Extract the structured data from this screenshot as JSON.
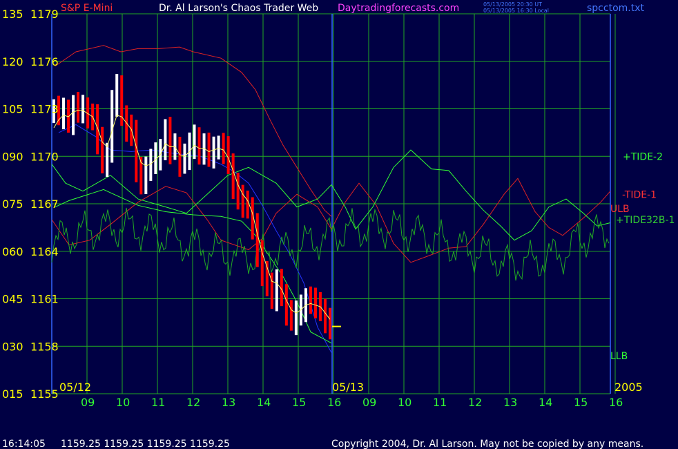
{
  "header": {
    "instrument": "S&P E-Mini",
    "title": "Dr. Al Larson's Chaos Trader Web",
    "site": "Daytradingforecasts.com",
    "time1": "05/13/2005 20:30 UT",
    "time2": "05/13/2005 16:30 Local",
    "file": "spcctom.txt"
  },
  "dates": {
    "left": "05/12",
    "mid": "05/13",
    "year": "2005"
  },
  "footer": {
    "time": "16:14:05",
    "ohlc": "1159.25 1159.25 1159.25 1159.25",
    "copyright": "Copyright 2004, Dr. Al Larson. May not be copied by any means."
  },
  "colors": {
    "background": "#000044",
    "grid": "#22aa22",
    "axis": "#3366ff",
    "price_up": "#ffffff",
    "price_down": "#ff0000"
  },
  "chart_data": {
    "type": "line",
    "title": "S&P E-Mini",
    "y_left_ticks": [
      "015",
      "030",
      "045",
      "060",
      "075",
      "090",
      "105",
      "120",
      "135"
    ],
    "y_price_ticks": [
      "1155",
      "1158",
      "1161",
      "1164",
      "1167",
      "1170",
      "1173",
      "1176",
      "1179"
    ],
    "ylim": [
      1155,
      1179
    ],
    "x_ticks": [
      "09",
      "10",
      "11",
      "12",
      "13",
      "14",
      "15",
      "16",
      "09",
      "10",
      "11",
      "12",
      "13",
      "14",
      "15",
      "16"
    ],
    "session_dates": [
      "05/12",
      "05/13"
    ],
    "series_labels": [
      {
        "name": "+TIDE-2",
        "color": "#33ff33"
      },
      {
        "name": "-TIDE-1",
        "color": "#ff3333"
      },
      {
        "name": "ULB",
        "color": "#ff3333"
      },
      {
        "name": "+TIDE32B-1",
        "color": "#33cc33"
      },
      {
        "name": "LLB",
        "color": "#33ff33"
      }
    ],
    "price": [
      1173.0,
      1172.6,
      1172.8,
      1172.2,
      1173.2,
      1172.9,
      1173.0,
      1172.6,
      1172.4,
      1171.0,
      1169.6,
      1170.2,
      1173.4,
      1174.3,
      1172.6,
      1171.8,
      1171.4,
      1169.2,
      1168.4,
      1169.3,
      1169.6,
      1170.0,
      1170.4,
      1171.6,
      1170.4,
      1170.6,
      1169.6,
      1170.0,
      1170.6,
      1171.2,
      1170.3,
      1170.6,
      1170.1,
      1170.5,
      1170.6,
      1170.4,
      1169.5,
      1168.2,
      1167.3,
      1167.0,
      1166.8,
      1165.6,
      1163.8,
      1162.6,
      1162.0,
      1161.1,
      1162.0,
      1161.2,
      1160.2,
      1159.6,
      1160.0,
      1160.4,
      1161.0,
      1160.8,
      1160.6,
      1160.4,
      1159.6,
      1159.3
    ],
    "ma_fast": [
      1171.8,
      1172.3,
      1172.6,
      1172.5,
      1172.8,
      1172.9,
      1172.9,
      1172.7,
      1172.5,
      1171.8,
      1170.9,
      1170.6,
      1171.6,
      1172.6,
      1172.5,
      1172.1,
      1171.7,
      1170.6,
      1169.6,
      1169.4,
      1169.5,
      1169.8,
      1170.1,
      1170.8,
      1170.6,
      1170.6,
      1170.1,
      1170.0,
      1170.3,
      1170.7,
      1170.5,
      1170.5,
      1170.3,
      1170.4,
      1170.5,
      1170.4,
      1169.9,
      1169.1,
      1168.2,
      1167.6,
      1167.2,
      1166.4,
      1165.1,
      1163.9,
      1163.0,
      1162.1,
      1162.0,
      1161.6,
      1160.9,
      1160.3,
      1160.1,
      1160.3,
      1160.6,
      1160.7,
      1160.6,
      1160.5,
      1160.1,
      1159.7
    ],
    "tide2": [
      [
        75,
        1169.5
      ],
      [
        95,
        1168.3
      ],
      [
        120,
        1167.8
      ],
      [
        160,
        1168.8
      ],
      [
        200,
        1167.3
      ],
      [
        240,
        1166.8
      ],
      [
        270,
        1166.4
      ],
      [
        300,
        1167.6
      ],
      [
        330,
        1168.8
      ],
      [
        360,
        1169.3
      ],
      [
        400,
        1168.3
      ],
      [
        430,
        1166.8
      ],
      [
        460,
        1167.3
      ],
      [
        480,
        1168.2
      ],
      [
        500,
        1166.8
      ],
      [
        515,
        1165.4
      ],
      [
        540,
        1166.8
      ],
      [
        570,
        1169.3
      ],
      [
        595,
        1170.4
      ],
      [
        625,
        1169.2
      ],
      [
        650,
        1169.1
      ],
      [
        675,
        1167.8
      ],
      [
        700,
        1166.6
      ],
      [
        725,
        1165.6
      ],
      [
        745,
        1164.7
      ],
      [
        770,
        1165.3
      ],
      [
        795,
        1166.8
      ],
      [
        820,
        1167.3
      ],
      [
        845,
        1166.4
      ],
      [
        865,
        1165.6
      ],
      [
        884,
        1165.8
      ]
    ],
    "tide1": [
      [
        75,
        1166.0
      ],
      [
        100,
        1164.4
      ],
      [
        130,
        1164.7
      ],
      [
        160,
        1165.7
      ],
      [
        200,
        1167.1
      ],
      [
        240,
        1168.1
      ],
      [
        270,
        1167.7
      ],
      [
        300,
        1166.0
      ],
      [
        320,
        1164.7
      ],
      [
        360,
        1164.1
      ],
      [
        380,
        1164.8
      ],
      [
        400,
        1166.4
      ],
      [
        430,
        1167.6
      ],
      [
        460,
        1166.8
      ],
      [
        480,
        1165.4
      ],
      [
        500,
        1167.1
      ],
      [
        520,
        1168.3
      ],
      [
        545,
        1166.9
      ],
      [
        570,
        1164.5
      ],
      [
        595,
        1163.3
      ],
      [
        620,
        1163.7
      ],
      [
        650,
        1164.2
      ],
      [
        675,
        1164.3
      ],
      [
        700,
        1165.7
      ],
      [
        730,
        1167.6
      ],
      [
        750,
        1168.6
      ],
      [
        775,
        1166.5
      ],
      [
        795,
        1165.5
      ],
      [
        815,
        1165.0
      ],
      [
        845,
        1166.1
      ],
      [
        870,
        1167.1
      ],
      [
        884,
        1167.8
      ]
    ],
    "ulb": [
      [
        80,
        1175.7
      ],
      [
        110,
        1176.6
      ],
      [
        150,
        1177.0
      ],
      [
        175,
        1176.6
      ],
      [
        200,
        1176.8
      ],
      [
        230,
        1176.8
      ],
      [
        260,
        1176.9
      ],
      [
        280,
        1176.6
      ],
      [
        320,
        1176.2
      ],
      [
        350,
        1175.3
      ],
      [
        370,
        1174.2
      ],
      [
        390,
        1172.4
      ],
      [
        410,
        1170.7
      ],
      [
        430,
        1169.3
      ],
      [
        450,
        1167.9
      ],
      [
        470,
        1166.6
      ],
      [
        480,
        1166.2
      ]
    ],
    "llb": [
      [
        85,
        1171.5
      ],
      [
        110,
        1172.0
      ],
      [
        140,
        1171.2
      ],
      [
        160,
        1170.4
      ],
      [
        190,
        1170.3
      ],
      [
        220,
        1170.4
      ],
      [
        250,
        1170.2
      ],
      [
        290,
        1170.0
      ],
      [
        320,
        1169.5
      ],
      [
        340,
        1169.0
      ],
      [
        360,
        1168.3
      ],
      [
        380,
        1166.9
      ],
      [
        400,
        1165.3
      ],
      [
        420,
        1163.8
      ],
      [
        440,
        1162.0
      ],
      [
        460,
        1159.2
      ],
      [
        480,
        1157.6
      ]
    ],
    "env_low": [
      [
        80,
        1166.8
      ],
      [
        100,
        1167.2
      ],
      [
        150,
        1167.9
      ],
      [
        200,
        1166.9
      ],
      [
        240,
        1166.5
      ],
      [
        280,
        1166.3
      ],
      [
        320,
        1166.2
      ],
      [
        350,
        1165.9
      ],
      [
        370,
        1165.0
      ],
      [
        390,
        1163.7
      ],
      [
        410,
        1162.4
      ],
      [
        430,
        1160.8
      ],
      [
        450,
        1158.9
      ],
      [
        480,
        1158.2
      ]
    ]
  }
}
